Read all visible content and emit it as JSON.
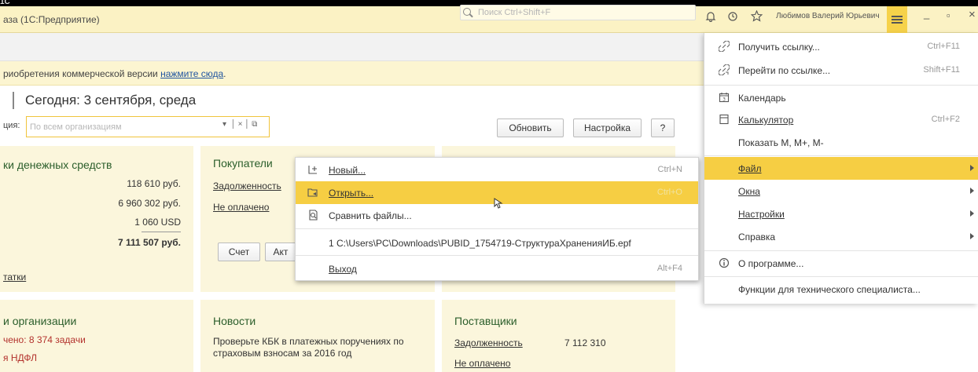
{
  "top": {
    "corner_text": "1С"
  },
  "titlebar": {
    "title": "аза  (1С:Предприятие)",
    "search_placeholder": "Поиск Ctrl+Shift+F",
    "user": "Любимов Валерий Юрьевич",
    "minimize": "_",
    "restore": "▫",
    "close": "×"
  },
  "notice": {
    "text": "риобретения коммерческой версии ",
    "link": "нажмите сюда",
    "end": "."
  },
  "page": {
    "today": "Сегодня: 3 сентября, среда",
    "org_label": "ция:",
    "org_placeholder": "По всем организациям",
    "refresh": "Обновить",
    "settings": "Настройка",
    "help": "?"
  },
  "card_money": {
    "title": "ки денежных средств",
    "values": [
      "118 610 руб.",
      "6 960 302 руб.",
      "1 060 USD"
    ],
    "total": "7 111 507 руб.",
    "link": "татки"
  },
  "card_buyers": {
    "title": "Покупатели",
    "debt": "Задолженность",
    "unpaid": "Не оплачено",
    "btn_invoice": "Счет",
    "btn_act": "Акт"
  },
  "card_org": {
    "title": "и организации",
    "tasks": "чено: 8 374 задачи",
    "ndfl": "я НДФЛ"
  },
  "card_news": {
    "title": "Новости",
    "line1": "Проверьте КБК в платежных поручениях по",
    "line2": "страховым взносам за 2016 год"
  },
  "card_suppliers": {
    "title": "Поставщики",
    "debt": "Задолженность",
    "debt_value": "7 112 310",
    "unpaid": "Не оплачено"
  },
  "file_menu": {
    "new": "Новый...",
    "new_sc": "Ctrl+N",
    "open": "Открыть...",
    "open_sc": "Ctrl+O",
    "compare": "Сравнить файлы...",
    "recent": "1 C:\\Users\\PC\\Downloads\\PUBID_1754719-СтруктураХраненияИБ.epf",
    "exit": "Выход",
    "exit_sc": "Alt+F4"
  },
  "main_menu": {
    "get_link": "Получить ссылку...",
    "get_link_sc": "Ctrl+F11",
    "go_link": "Перейти по ссылке...",
    "go_link_sc": "Shift+F11",
    "calendar": "Календарь",
    "calculator": "Калькулятор",
    "calculator_sc": "Ctrl+F2",
    "show_m": "Показать М, М+, М-",
    "file": "Файл",
    "windows": "Окна",
    "settings": "Настройки",
    "help": "Справка",
    "about": "О программе...",
    "tech": "Функции для технического специалиста..."
  }
}
